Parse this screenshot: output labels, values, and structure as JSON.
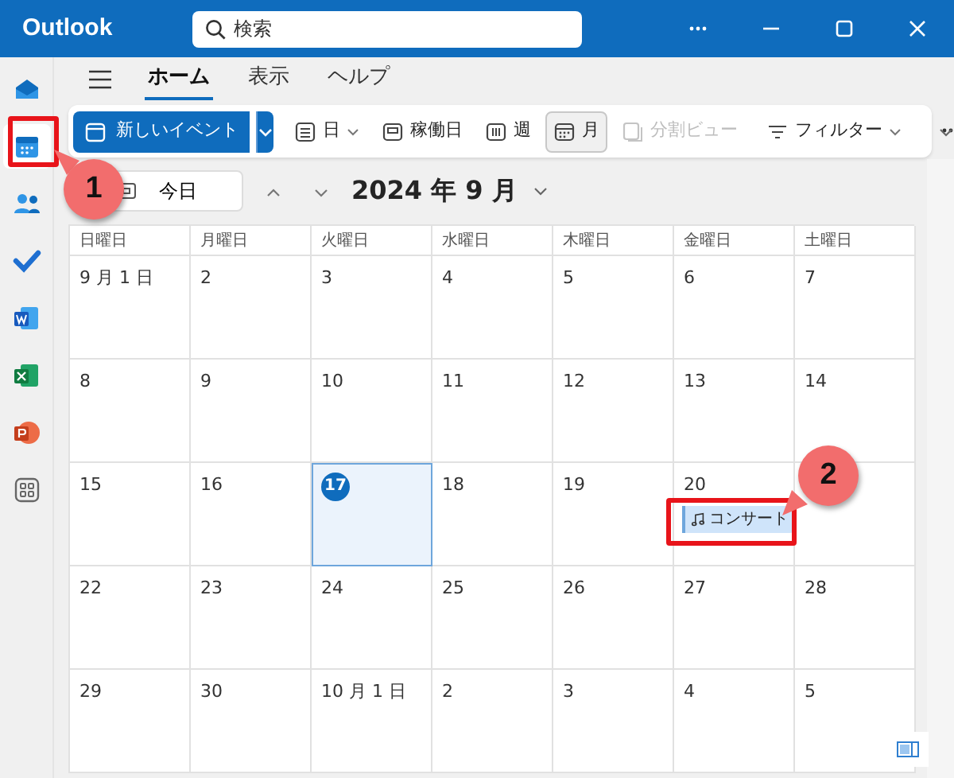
{
  "app": {
    "title": "Outlook"
  },
  "search": {
    "placeholder": "検索"
  },
  "rail": [
    {
      "kind": "mail",
      "selected": false
    },
    {
      "kind": "calendar",
      "selected": true
    },
    {
      "kind": "people",
      "selected": false
    },
    {
      "kind": "todo",
      "selected": false
    },
    {
      "kind": "word",
      "selected": false
    },
    {
      "kind": "excel",
      "selected": false
    },
    {
      "kind": "powerpoint",
      "selected": false
    },
    {
      "kind": "apps",
      "selected": false
    }
  ],
  "tabs": [
    {
      "label": "ホーム",
      "selected": true
    },
    {
      "label": "表示",
      "selected": false
    },
    {
      "label": "ヘルプ",
      "selected": false
    }
  ],
  "ribbon": {
    "new_event": "新しいイベント",
    "views": [
      {
        "kind": "day",
        "label": "日",
        "dropdown": true,
        "selected": false,
        "disabled": false
      },
      {
        "kind": "workweek",
        "label": "稼働日",
        "dropdown": false,
        "selected": false,
        "disabled": false
      },
      {
        "kind": "week",
        "label": "週",
        "dropdown": false,
        "selected": false,
        "disabled": false
      },
      {
        "kind": "month",
        "label": "月",
        "dropdown": false,
        "selected": true,
        "disabled": false
      },
      {
        "kind": "split",
        "label": "分割ビュー",
        "dropdown": false,
        "selected": false,
        "disabled": true
      }
    ],
    "filter": "フィルター"
  },
  "navigation": {
    "today": "今日",
    "month_label": "2024 年 9 月"
  },
  "calendar": {
    "weekdays": [
      "日曜日",
      "月曜日",
      "火曜日",
      "水曜日",
      "木曜日",
      "金曜日",
      "土曜日"
    ],
    "weeks": [
      [
        {
          "date": "9 月 1 日",
          "today": false
        },
        {
          "date": "2",
          "today": false
        },
        {
          "date": "3",
          "today": false
        },
        {
          "date": "4",
          "today": false
        },
        {
          "date": "5",
          "today": false
        },
        {
          "date": "6",
          "today": false
        },
        {
          "date": "7",
          "today": false
        }
      ],
      [
        {
          "date": "8",
          "today": false
        },
        {
          "date": "9",
          "today": false
        },
        {
          "date": "10",
          "today": false
        },
        {
          "date": "11",
          "today": false
        },
        {
          "date": "12",
          "today": false
        },
        {
          "date": "13",
          "today": false
        },
        {
          "date": "14",
          "today": false
        }
      ],
      [
        {
          "date": "15",
          "today": false
        },
        {
          "date": "16",
          "today": false
        },
        {
          "date": "17",
          "today": true
        },
        {
          "date": "18",
          "today": false
        },
        {
          "date": "19",
          "today": false
        },
        {
          "date": "20",
          "today": false,
          "events": [
            {
              "title": "コンサート"
            }
          ]
        }
      ],
      [
        {
          "date": "22",
          "today": false
        },
        {
          "date": "23",
          "today": false
        },
        {
          "date": "24",
          "today": false
        },
        {
          "date": "25",
          "today": false
        },
        {
          "date": "26",
          "today": false
        },
        {
          "date": "27",
          "today": false
        },
        {
          "date": "28",
          "today": false
        }
      ],
      [
        {
          "date": "29",
          "today": false
        },
        {
          "date": "30",
          "today": false
        },
        {
          "date": "10 月 1 日",
          "today": false
        },
        {
          "date": "2",
          "today": false
        },
        {
          "date": "3",
          "today": false
        },
        {
          "date": "4",
          "today": false
        },
        {
          "date": "5",
          "today": false
        }
      ]
    ]
  },
  "annotations": [
    {
      "label": "1"
    },
    {
      "label": "2"
    }
  ]
}
